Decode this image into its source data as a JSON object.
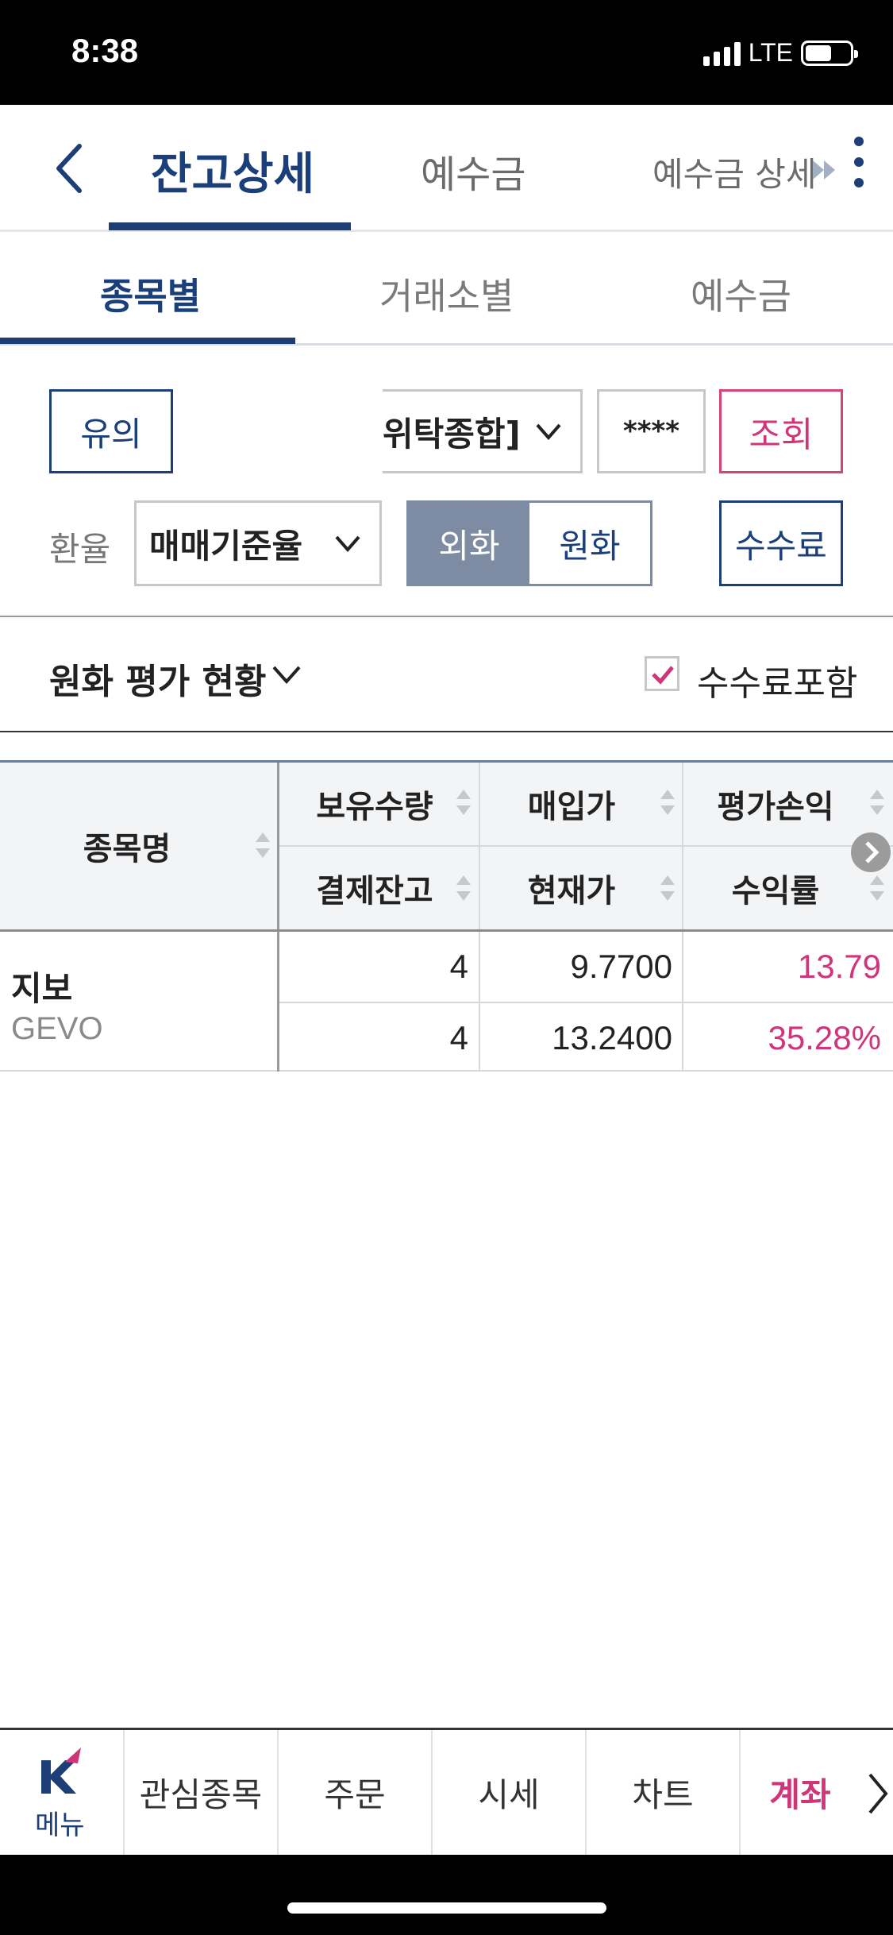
{
  "status": {
    "time": "8:38",
    "network": "LTE"
  },
  "top_nav": {
    "tabs": [
      "잔고상세",
      "예수금",
      "예수금 상세"
    ],
    "active_tab": "잔고상세",
    "accent": "#1e3e78"
  },
  "sub_tabs": {
    "tabs": [
      "종목별",
      "거래소별",
      "예수금"
    ],
    "active": "종목별"
  },
  "controls": {
    "notice_button": "유의",
    "account_select": "위탁종합]",
    "password_mask": "****",
    "query_button": "조회",
    "fx_label": "환율",
    "fx_select": "매매기준율",
    "currency_toggle": {
      "foreign": "외화",
      "krw": "원화",
      "selected": "외화"
    },
    "fee_button": "수수료"
  },
  "summary": {
    "label": "원화 평가 현황",
    "fee_checkbox_label": "수수료포함",
    "fee_checkbox_checked": true
  },
  "table": {
    "name_header": "종목명",
    "headers_top": [
      "보유수량",
      "매입가",
      "평가손익"
    ],
    "headers_bottom": [
      "결제잔고",
      "현재가",
      "수익률"
    ],
    "rows": [
      {
        "name": "지보",
        "code": "GEVO",
        "top": [
          "4",
          "9.7700",
          "13.79"
        ],
        "bottom": [
          "4",
          "13.2400",
          "35.28%"
        ]
      }
    ],
    "gain_color": "#d0357a"
  },
  "bottom_nav": {
    "menu_label": "메뉴",
    "items": [
      "관심종목",
      "주문",
      "시세",
      "차트",
      "계좌"
    ],
    "active": "계좌"
  }
}
